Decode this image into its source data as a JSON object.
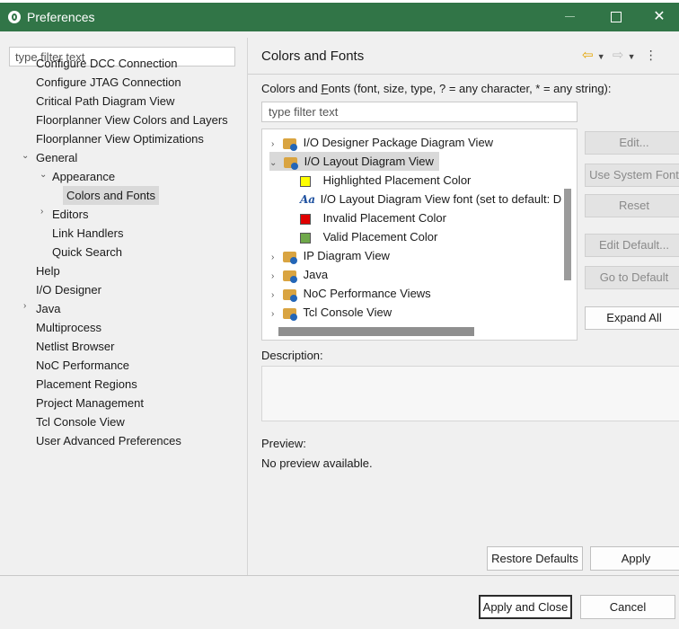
{
  "window": {
    "title": "Preferences"
  },
  "left": {
    "filter_placeholder": "type filter text",
    "items": [
      {
        "label": "Configure DCC Connection"
      },
      {
        "label": "Configure JTAG Connection"
      },
      {
        "label": "Critical Path Diagram View"
      },
      {
        "label": "Floorplanner View Colors and Layers"
      },
      {
        "label": "Floorplanner View Optimizations"
      },
      {
        "label": "General"
      },
      {
        "label": "Appearance"
      },
      {
        "label": "Colors and Fonts"
      },
      {
        "label": "Editors"
      },
      {
        "label": "Link Handlers"
      },
      {
        "label": "Quick Search"
      },
      {
        "label": "Help"
      },
      {
        "label": "I/O Designer"
      },
      {
        "label": "Java"
      },
      {
        "label": "Multiprocess"
      },
      {
        "label": "Netlist Browser"
      },
      {
        "label": "NoC Performance"
      },
      {
        "label": "Placement Regions"
      },
      {
        "label": "Project Management"
      },
      {
        "label": "Tcl Console View"
      },
      {
        "label": "User Advanced Preferences"
      }
    ]
  },
  "right": {
    "title": "Colors and Fonts",
    "desc_pre": "Colors and ",
    "desc_u": "F",
    "desc_post": "onts (font, size, type, ? = any character, * = any string):",
    "filter_placeholder": "type filter text",
    "tree": [
      {
        "label": "I/O Designer Package Diagram View"
      },
      {
        "label": "I/O Layout Diagram View"
      },
      {
        "label": "Highlighted Placement Color",
        "color": "#ffff00"
      },
      {
        "label": "I/O Layout Diagram View font (set to default: D",
        "icon": "font-icon",
        "glyph": "Aa"
      },
      {
        "label": "Invalid Placement Color",
        "color": "#e00000"
      },
      {
        "label": "Valid Placement Color",
        "color": "#6fa84a"
      },
      {
        "label": "IP Diagram View"
      },
      {
        "label": "Java"
      },
      {
        "label": "NoC Performance Views"
      },
      {
        "label": "Tcl Console View"
      }
    ],
    "buttons": {
      "edit": "Edit...",
      "use_system_font": "Use System Font",
      "reset": "Reset",
      "edit_default": "Edit Default...",
      "go_to_default": "Go to Default",
      "expand_all": "Expand All"
    },
    "description_label": "Description:",
    "preview_label": "Preview:",
    "preview_text": "No preview available.",
    "restore_defaults": "Restore Defaults",
    "apply": "Apply"
  },
  "footer": {
    "apply_and_close": "Apply and Close",
    "cancel": "Cancel"
  }
}
